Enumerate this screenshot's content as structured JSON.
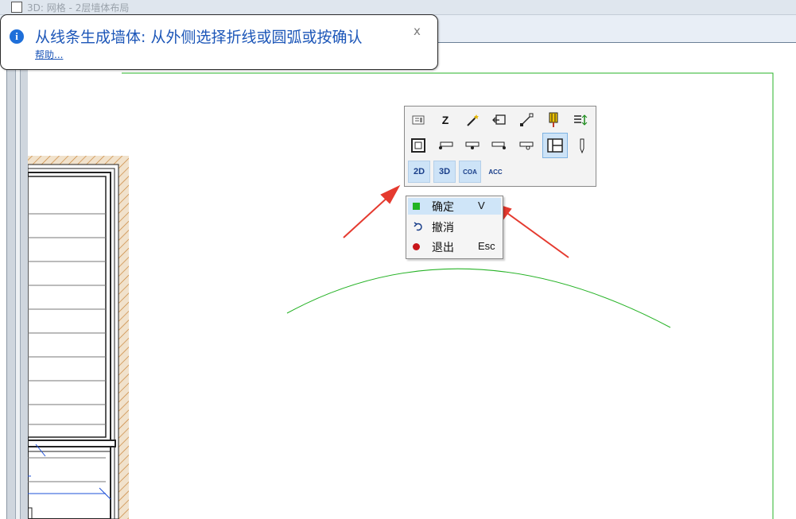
{
  "window": {
    "tab_title": "3D: 网格 - 2层墙体布局"
  },
  "tooltip": {
    "message": "从线条生成墙体: 从外侧选择折线或圆弧或按确认",
    "help_link": "帮助...",
    "close_glyph": "x"
  },
  "toolpanel": {
    "row1_icons": [
      "info-icon",
      "z-icon",
      "magic-wand-icon",
      "return-icon",
      "line-icon",
      "yellow-pin-icon",
      "align-icon"
    ],
    "row1_z_label": "Z",
    "row2_icons": [
      "frame-icon",
      "wall-left-icon",
      "wall-middle-icon",
      "wall-right-icon",
      "wall-offset-icon",
      "split-panel-icon",
      "pen-icon"
    ],
    "row3": {
      "btn_2d": "2D",
      "btn_3d": "3D",
      "btn_coa": "COA",
      "btn_acc": "ACC"
    }
  },
  "context_menu": {
    "items": [
      {
        "label": "确定",
        "shortcut": "V",
        "icon": "green-square-icon"
      },
      {
        "label": "撤消",
        "shortcut": "",
        "icon": "undo-arrow-icon"
      },
      {
        "label": "退出",
        "shortcut": "Esc",
        "icon": "red-dot-icon"
      }
    ]
  },
  "colors": {
    "accent_blue": "#1c56b8",
    "guide_green": "#27b327",
    "annotation_red": "#e53a2f",
    "wall_hatch": "#c9853a"
  }
}
